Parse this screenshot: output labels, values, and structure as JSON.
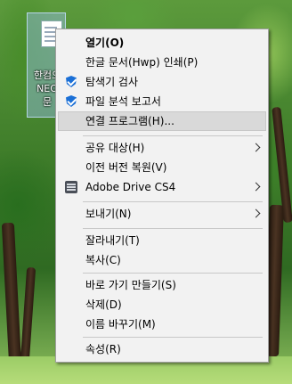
{
  "desktop_icon": {
    "label_lines": [
      "한컴오",
      "NEO",
      "문"
    ]
  },
  "context_menu": {
    "items": [
      {
        "label": "열기(O)",
        "bold": true
      },
      {
        "label": "한글 문서(Hwp) 인쇄(P)"
      },
      {
        "label": "탐색기 검사",
        "icon": "shield-check-icon"
      },
      {
        "label": "파일 분석 보고서",
        "icon": "shield-check-icon"
      },
      {
        "label": "연결 프로그램(H)...",
        "highlighted": true
      },
      {
        "label": "공유 대상(H)",
        "submenu": true
      },
      {
        "label": "이전 버전 복원(V)"
      },
      {
        "label": "Adobe Drive CS4",
        "icon": "adobe-drive-icon",
        "submenu": true
      },
      {
        "label": "보내기(N)",
        "submenu": true
      },
      {
        "label": "잘라내기(T)"
      },
      {
        "label": "복사(C)"
      },
      {
        "label": "바로 가기 만들기(S)"
      },
      {
        "label": "삭제(D)"
      },
      {
        "label": "이름 바꾸기(M)"
      },
      {
        "label": "속성(R)"
      }
    ]
  },
  "colors": {
    "menu_background": "#f2f2f2",
    "highlight": "#d9d9d9",
    "shield_blue": "#1a6fd6"
  }
}
